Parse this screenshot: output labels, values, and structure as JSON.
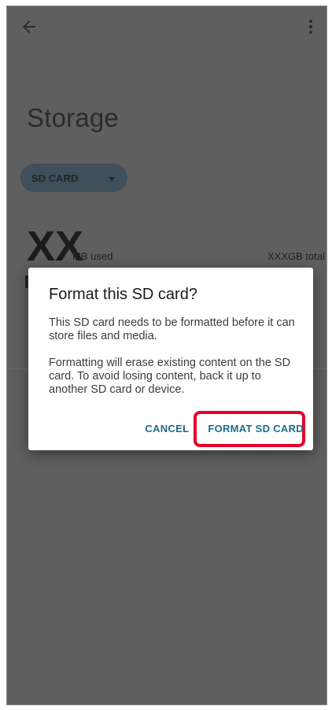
{
  "toolbar": {
    "back_icon": "arrow-back-icon",
    "more_icon": "more-vert-icon"
  },
  "page": {
    "title": "Storage"
  },
  "storage_selector": {
    "selected": "SD CARD"
  },
  "usage": {
    "used_value": "XX",
    "used_unit": "MB used",
    "total": "XXXGB total"
  },
  "dialog": {
    "title": "Format this SD card?",
    "paragraph1": "This SD card needs to be formatted before it can store files and media.",
    "paragraph2": "Formatting will erase existing content on the SD card. To avoid losing content, back it up to another SD card or device.",
    "cancel_label": "CANCEL",
    "confirm_label": "FORMAT SD CARD"
  },
  "colors": {
    "scrim_background": "#5f5f5f",
    "accent": "#1b6c8a",
    "highlight": "#e4002b"
  }
}
